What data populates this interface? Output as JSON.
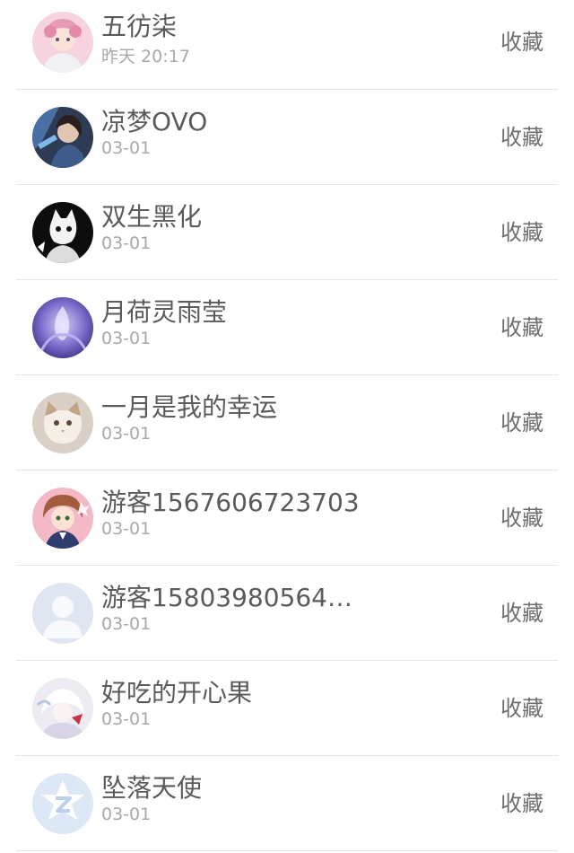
{
  "list": {
    "items": [
      {
        "name": "五彷柒",
        "time": "昨天 20:17",
        "action": "收藏",
        "avatar_icon": "anime-pink-girl-icon",
        "avatar_color": "#f4c6d6"
      },
      {
        "name": "凉梦OVO",
        "time": "03-01",
        "action": "收藏",
        "avatar_icon": "game-character-icon",
        "avatar_color": "#3b4a66"
      },
      {
        "name": "双生黑化",
        "time": "03-01",
        "action": "收藏",
        "avatar_icon": "black-white-cat-icon",
        "avatar_color": "#1a1a1a"
      },
      {
        "name": "月荷灵雨莹",
        "time": "03-01",
        "action": "收藏",
        "avatar_icon": "purple-fantasy-icon",
        "avatar_color": "#6b5fb0"
      },
      {
        "name": "一月是我的幸运",
        "time": "03-01",
        "action": "收藏",
        "avatar_icon": "cat-photo-icon",
        "avatar_color": "#c9b8a8"
      },
      {
        "name": "游客1567606723703",
        "time": "03-01",
        "action": "收藏",
        "avatar_icon": "anime-girl-icon",
        "avatar_color": "#e89aa8"
      },
      {
        "name": "游客15803980564…",
        "time": "03-01",
        "action": "收藏",
        "avatar_icon": "default-user-icon",
        "avatar_color": "#d5dff0"
      },
      {
        "name": "好吃的开心果",
        "time": "03-01",
        "action": "收藏",
        "avatar_icon": "white-anime-icon",
        "avatar_color": "#e8e4ec"
      },
      {
        "name": "坠落天使",
        "time": "03-01",
        "action": "收藏",
        "avatar_icon": "qq-logo-icon",
        "avatar_color": "#dce6f4"
      }
    ]
  }
}
